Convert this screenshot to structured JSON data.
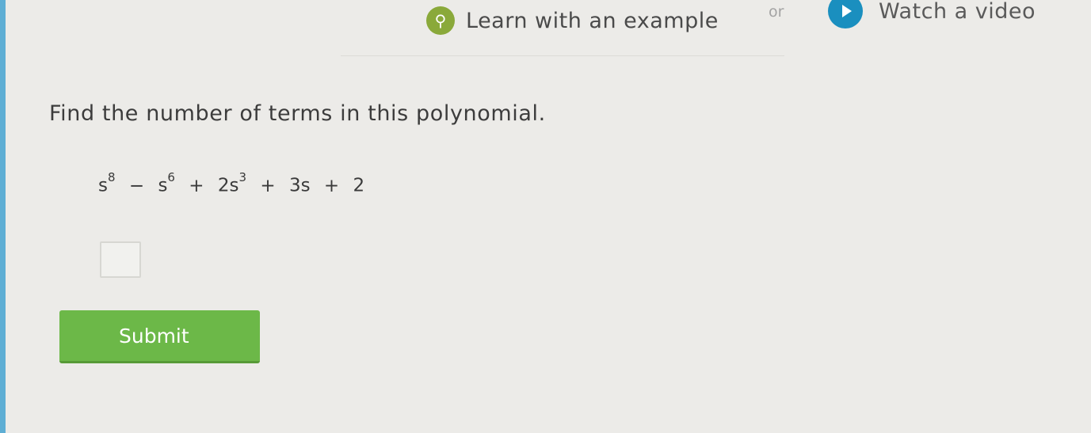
{
  "header": {
    "learn_label": "Learn with an example",
    "or_label": "or",
    "video_label": "Watch a video"
  },
  "question": {
    "prompt": "Find the number of terms in this polynomial.",
    "polynomial": {
      "t1_base": "s",
      "t1_exp": "8",
      "op1": "−",
      "t2_base": "s",
      "t2_exp": "6",
      "op2": "+",
      "t3_base": "2s",
      "t3_exp": "3",
      "op3": "+",
      "t4": "3s",
      "op4": "+",
      "t5": "2"
    }
  },
  "answer": {
    "value": "",
    "placeholder": ""
  },
  "submit": {
    "label": "Submit"
  },
  "colors": {
    "background": "#ecebe8",
    "bulb": "#8aa93a",
    "play": "#1a8fbf",
    "submit": "#6cb848",
    "edge": "#5eaed4"
  },
  "icons": {
    "learn": "lightbulb-icon",
    "video": "play-icon"
  }
}
